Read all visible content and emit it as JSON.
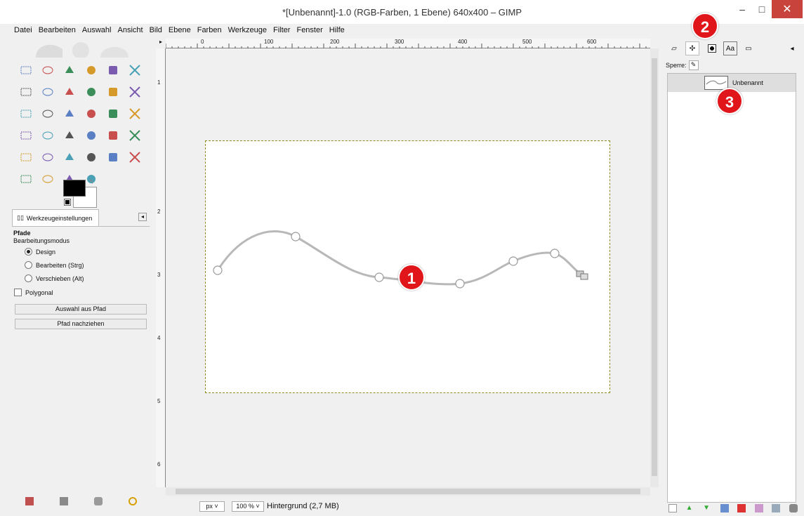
{
  "window": {
    "title": "*[Unbenannt]-1.0 (RGB-Farben, 1 Ebene) 640x400 – GIMP",
    "min": "–",
    "max": "□",
    "close": "✕"
  },
  "menu": [
    "Datei",
    "Bearbeiten",
    "Auswahl",
    "Ansicht",
    "Bild",
    "Ebene",
    "Farben",
    "Werkzeuge",
    "Filter",
    "Fenster",
    "Hilfe"
  ],
  "tool_options": {
    "tab_label": "Werkzeugeinstellungen",
    "title": "Pfade",
    "mode_label": "Bearbeitungsmodus",
    "modes": [
      "Design",
      "Bearbeiten (Strg)",
      "Verschieben (Alt)"
    ],
    "selected_mode": "Design",
    "polygonal": "Polygonal",
    "btn_selection": "Auswahl aus Pfad",
    "btn_stroke": "Pfad nachziehen"
  },
  "ruler": {
    "top": [
      "0",
      "100",
      "200",
      "300",
      "400",
      "500",
      "600"
    ],
    "left": [
      "1",
      "2",
      "3",
      "4",
      "5",
      "6"
    ]
  },
  "status": {
    "unit": "px",
    "zoom": "100 %",
    "text": "Hintergrund (2,7 MB)"
  },
  "dock": {
    "lock_label": "Sperre:",
    "path_name": "Unbenannt"
  },
  "tool_names": [
    "rect-select",
    "ellipse-select",
    "free-select",
    "fuzzy-select",
    "by-color-select",
    "scissors",
    "foreground-select",
    "paths",
    "color-picker",
    "zoom",
    "measure",
    "move",
    "align",
    "crop",
    "rotate",
    "scale",
    "shear",
    "perspective",
    "flip",
    "cage",
    "text",
    "bucket-fill",
    "blend",
    "pencil",
    "paintbrush",
    "eraser",
    "airbrush",
    "ink",
    "clone",
    "heal",
    "perspective-clone",
    "blur",
    "smudge",
    "dodge-burn"
  ],
  "annotations": [
    "1",
    "2",
    "3"
  ],
  "colors": {
    "accent": "#e0161b",
    "selection": "#8a8a20",
    "path": "#b8b8b8"
  }
}
